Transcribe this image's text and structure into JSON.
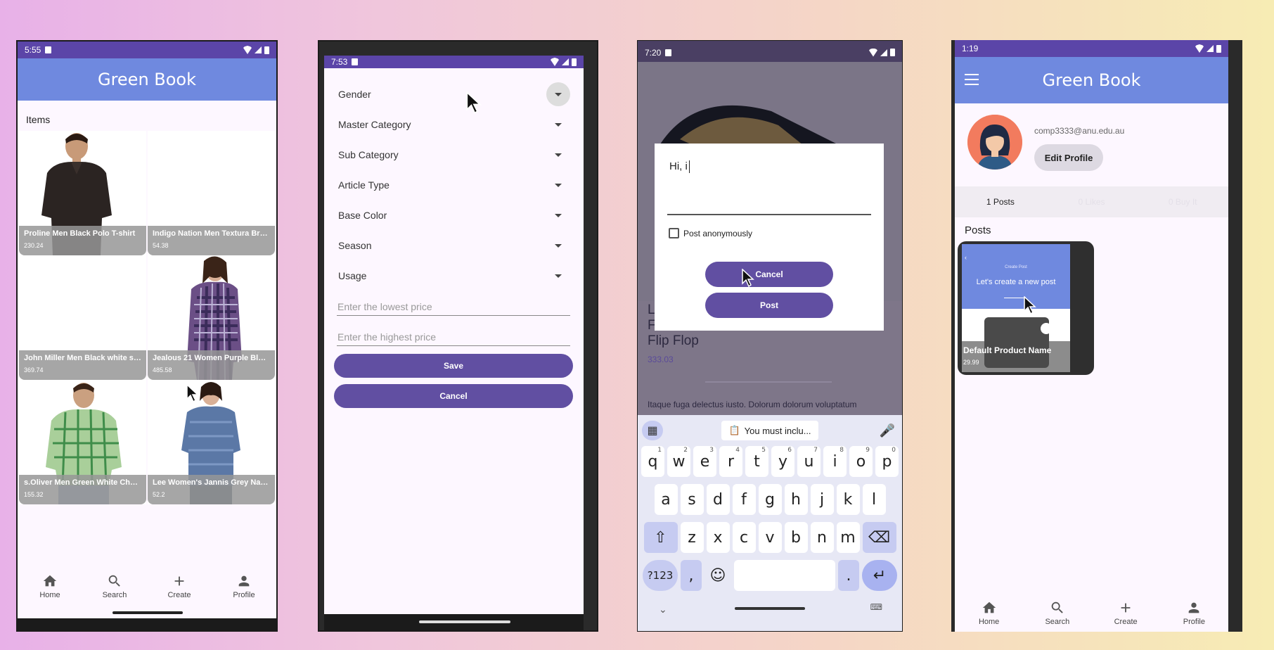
{
  "screen1": {
    "status_time": "5:55",
    "app_title": "Green Book",
    "items_label": "Items",
    "items": [
      {
        "name": "Proline Men Black Polo T-shirt",
        "price": "230.24"
      },
      {
        "name": "Indigo Nation Men Textura Bro...",
        "price": "54.38"
      },
      {
        "name": "John Miller Men Black white sm...",
        "price": "369.74"
      },
      {
        "name": "Jealous 21 Women Purple Blue...",
        "price": "485.58"
      },
      {
        "name": "s.Oliver Men Green White Chec...",
        "price": "155.32"
      },
      {
        "name": "Lee Women's Jannis Grey Navy...",
        "price": "52.2"
      }
    ],
    "nav": {
      "home": "Home",
      "search": "Search",
      "create": "Create",
      "profile": "Profile"
    }
  },
  "screen2": {
    "status_time": "7:53",
    "filters": [
      "Gender",
      "Master Category",
      "Sub Category",
      "Article Type",
      "Base Color",
      "Season",
      "Usage"
    ],
    "lowest_price_placeholder": "Enter the lowest price",
    "highest_price_placeholder": "Enter the highest price",
    "save_label": "Save",
    "cancel_label": "Cancel"
  },
  "screen3": {
    "status_time": "7:20",
    "behind_title_lines": [
      "L",
      "F",
      "Flip Flop"
    ],
    "behind_price": "333.03",
    "behind_description": "Itaque fuga delectus iusto. Dolorum dolorum voluptatum",
    "comment_text": "Hi, i",
    "anonymous_label": "Post anonymously",
    "cancel_label": "Cancel",
    "post_label": "Post",
    "suggestion": "You must inclu...",
    "keyboard": {
      "row1": [
        [
          "q",
          "1"
        ],
        [
          "w",
          "2"
        ],
        [
          "e",
          "3"
        ],
        [
          "r",
          "4"
        ],
        [
          "t",
          "5"
        ],
        [
          "y",
          "6"
        ],
        [
          "u",
          "7"
        ],
        [
          "i",
          "8"
        ],
        [
          "o",
          "9"
        ],
        [
          "p",
          "0"
        ]
      ],
      "row2": [
        "a",
        "s",
        "d",
        "f",
        "g",
        "h",
        "j",
        "k",
        "l"
      ],
      "row3": [
        "z",
        "x",
        "c",
        "v",
        "b",
        "n",
        "m"
      ],
      "sym_label": "?123",
      "comma": ",",
      "period": "."
    }
  },
  "screen4": {
    "status_time": "1:19",
    "app_title": "Green Book",
    "email": "comp3333@anu.edu.au",
    "edit_profile_label": "Edit Profile",
    "tabs": [
      "1 Posts",
      "0 Likes",
      "0 Buy It"
    ],
    "posts_label": "Posts",
    "post": {
      "mini_header": "Create Post",
      "mini_title": "Let's create a new post",
      "product_name": "Default Product Name",
      "price": "29.99"
    },
    "nav": {
      "home": "Home",
      "search": "Search",
      "create": "Create",
      "profile": "Profile"
    }
  }
}
